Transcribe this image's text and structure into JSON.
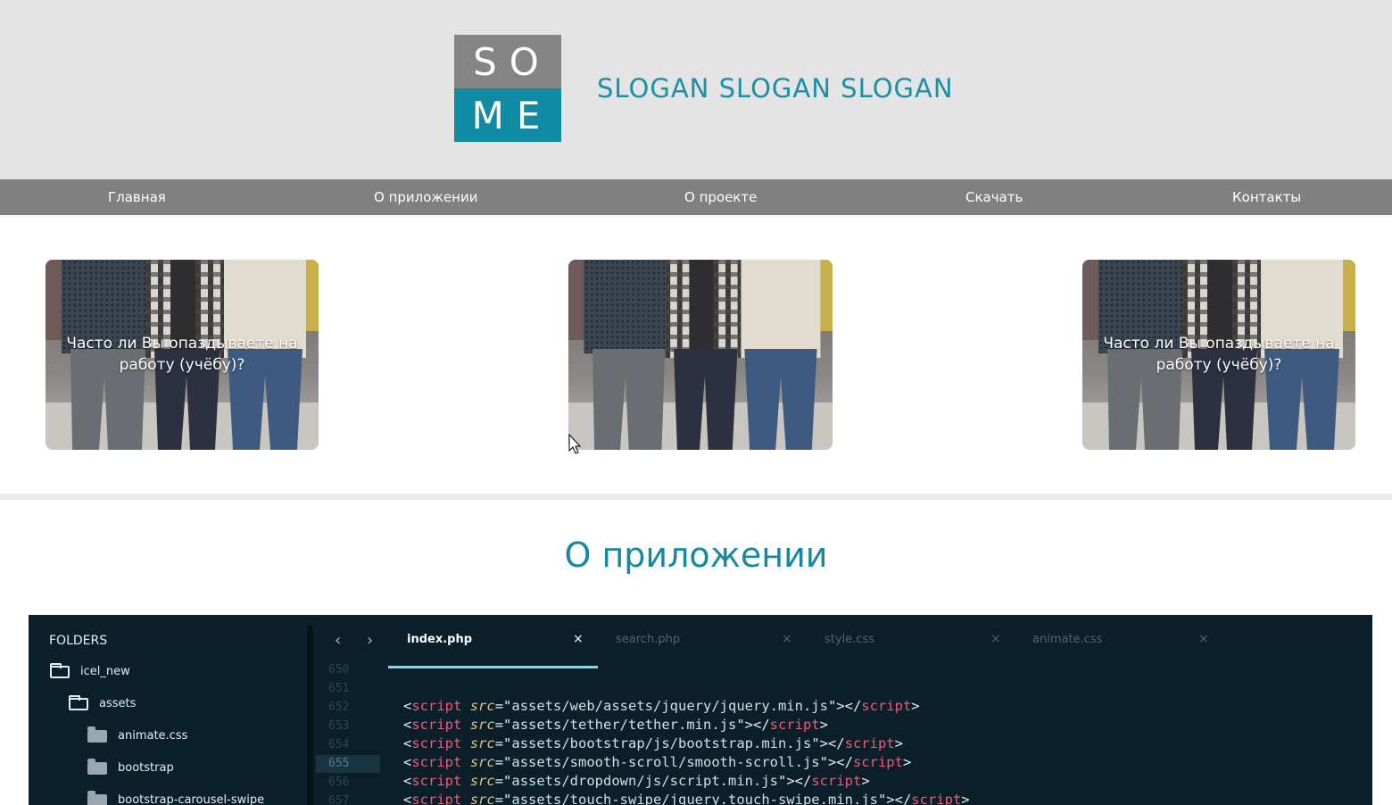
{
  "header": {
    "logo_top": "SO",
    "logo_bottom": "ME",
    "slogan": "SLOGAN SLOGAN SLOGAN"
  },
  "nav": {
    "items": [
      "Главная",
      "О приложении",
      "О проекте",
      "Скачать",
      "Контакты"
    ]
  },
  "cards": [
    {
      "caption": "Часто ли Вы опаздываете на работу (учёбу)?"
    },
    {
      "caption": ""
    },
    {
      "caption": "Часто ли Вы опаздываете на работу (учёбу)?"
    }
  ],
  "section": {
    "title": "О приложении"
  },
  "editor": {
    "folders_title": "FOLDERS",
    "tree": [
      "icel_new",
      "assets",
      "animate.css",
      "bootstrap",
      "bootstrap-carousel-swipe"
    ],
    "tabs": [
      "index.php",
      "search.php",
      "style.css",
      "animate.css"
    ],
    "active_tab": "index.php",
    "line_numbers": [
      "650",
      "651",
      "652",
      "653",
      "654",
      "655",
      "656",
      "657"
    ],
    "current_line": "655",
    "code_paths": [
      "assets/web/assets/jquery/jquery.min.js",
      "assets/tether/tether.min.js",
      "assets/bootstrap/js/bootstrap.min.js",
      "assets/smooth-scroll/smooth-scroll.js",
      "assets/dropdown/js/script.min.js",
      "assets/touch-swipe/jquery.touch-swipe.min.js"
    ]
  },
  "colors": {
    "accent": "#118aa3",
    "header_bg": "#e4e4e4",
    "nav_bg": "#808080",
    "editor_bg": "#0b1f2a"
  }
}
